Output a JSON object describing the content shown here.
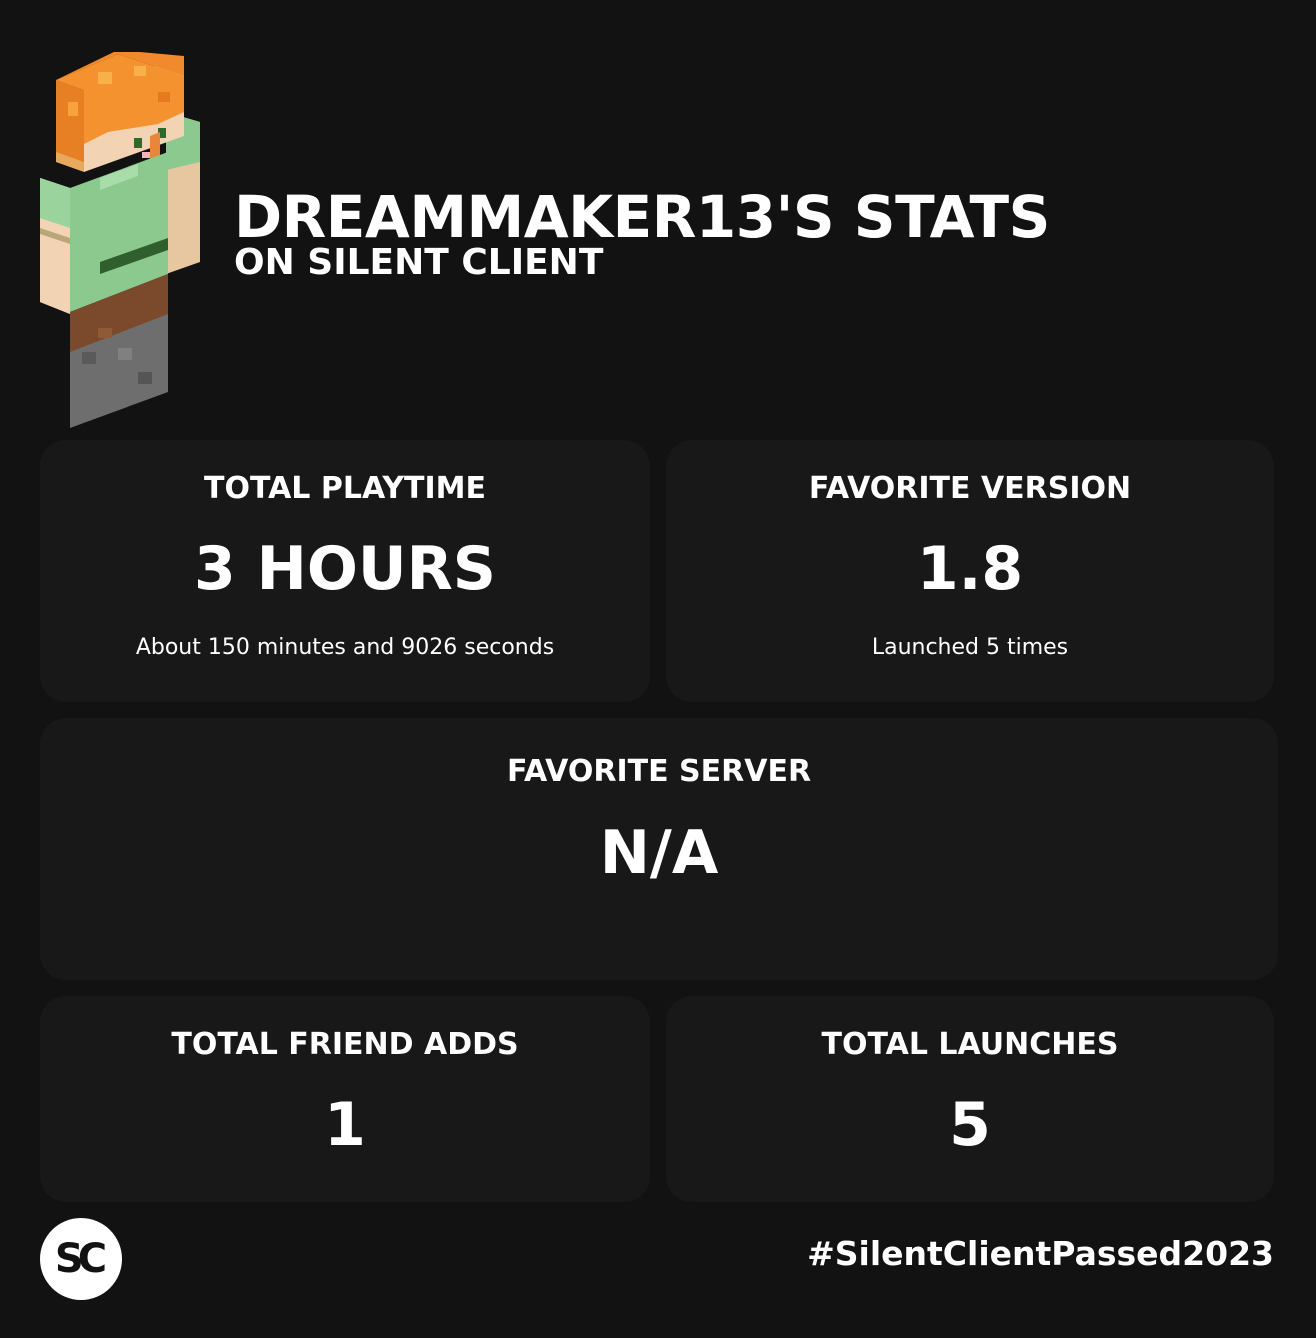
{
  "header": {
    "title": "DREAMMAKER13'S STATS",
    "subtitle": "ON SILENT CLIENT"
  },
  "avatar": {
    "icon": "minecraft-skin-avatar"
  },
  "stats": {
    "playtime": {
      "label": "TOTAL PLAYTIME",
      "value": "3 HOURS",
      "note": "About 150 minutes and 9026 seconds"
    },
    "version": {
      "label": "FAVORITE VERSION",
      "value": "1.8",
      "note": "Launched 5 times"
    },
    "server": {
      "label": "FAVORITE SERVER",
      "value": "N/A"
    },
    "friends": {
      "label": "TOTAL FRIEND ADDS",
      "value": "1"
    },
    "launches": {
      "label": "TOTAL LAUNCHES",
      "value": "5"
    }
  },
  "footer": {
    "logo_text": "SC",
    "hashtag": "#SilentClientPassed2023"
  },
  "colors": {
    "background": "#121212",
    "card": "#181818",
    "text": "#ffffff"
  }
}
